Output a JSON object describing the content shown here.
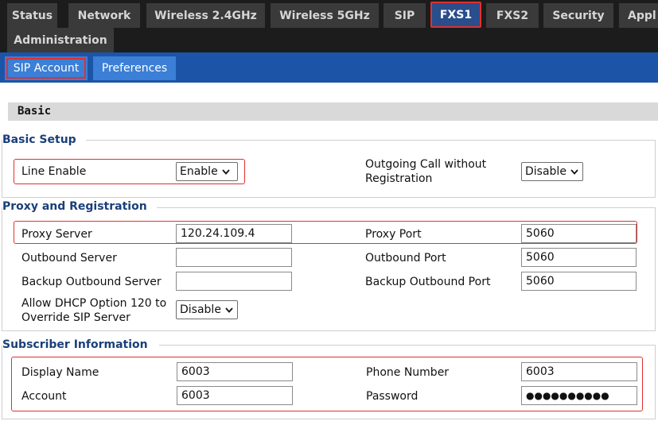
{
  "nav": {
    "tabs": [
      {
        "label": "Status"
      },
      {
        "label": "Network"
      },
      {
        "label": "Wireless 2.4GHz"
      },
      {
        "label": "Wireless 5GHz"
      },
      {
        "label": "SIP"
      },
      {
        "label": "FXS1"
      },
      {
        "label": "FXS2"
      },
      {
        "label": "Security"
      },
      {
        "label": "Appl"
      },
      {
        "label": "Administration"
      }
    ],
    "active": "FXS1"
  },
  "subnav": {
    "tabs": [
      {
        "label": "SIP Account"
      },
      {
        "label": "Preferences"
      }
    ],
    "active": "SIP Account"
  },
  "section": {
    "title": "Basic"
  },
  "basic_setup": {
    "title": "Basic Setup",
    "line_enable_label": "Line Enable",
    "line_enable_value": "Enable",
    "outgoing_label_1": "Outgoing Call without",
    "outgoing_label_2": "Registration",
    "outgoing_value": "Disable"
  },
  "proxy": {
    "title": "Proxy and Registration",
    "proxy_server_label": "Proxy Server",
    "proxy_server_value": "120.24.109.4",
    "proxy_port_label": "Proxy Port",
    "proxy_port_value": "5060",
    "outbound_server_label": "Outbound Server",
    "outbound_server_value": "",
    "outbound_port_label": "Outbound Port",
    "outbound_port_value": "5060",
    "backup_server_label": "Backup Outbound Server",
    "backup_server_value": "",
    "backup_port_label": "Backup Outbound Port",
    "backup_port_value": "5060",
    "dhcp_label_1": "Allow DHCP Option 120 to",
    "dhcp_label_2": "Override SIP Server",
    "dhcp_value": "Disable"
  },
  "subscriber": {
    "title": "Subscriber Information",
    "display_name_label": "Display Name",
    "display_name_value": "6003",
    "phone_number_label": "Phone Number",
    "phone_number_value": "6003",
    "account_label": "Account",
    "account_value": "6003",
    "password_label": "Password",
    "password_value": "●●●●●●●●●●"
  },
  "colors": {
    "topnav_bg": "#1c1c1c",
    "tab_bg": "#3a3a3a",
    "tab_active_bg": "#2a4d8c",
    "subnav_bg": "#1c54a8",
    "subtab_bg": "#3b7fd6",
    "highlight": "#e03030",
    "group_title": "#1a3f7a"
  }
}
